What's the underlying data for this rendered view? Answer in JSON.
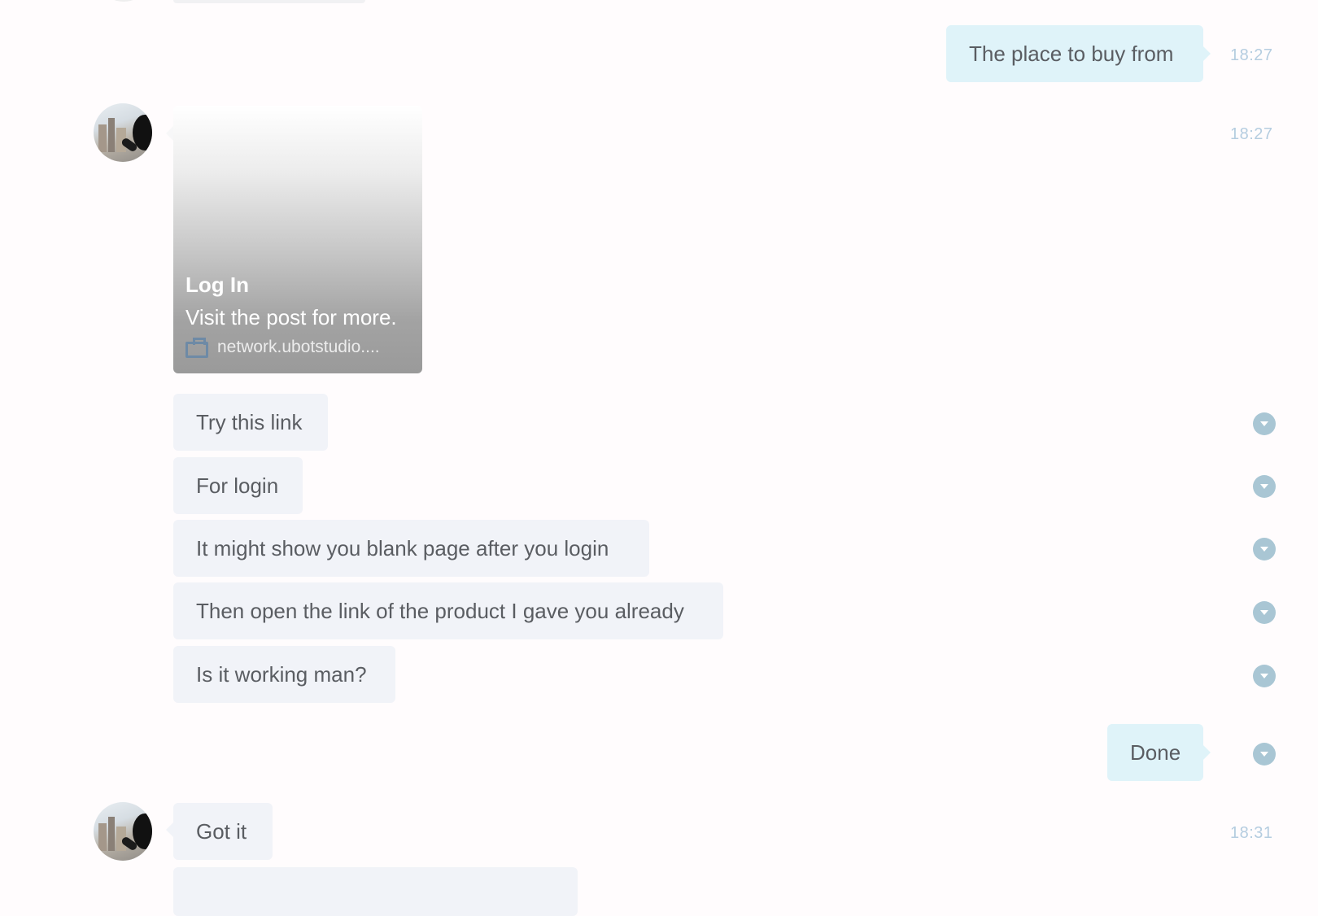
{
  "messages": {
    "out_1": {
      "text": "The place to buy from",
      "time": "18:27"
    },
    "card": {
      "time": "18:27",
      "title": "Log In",
      "description": "Visit the post for more.",
      "site": "network.ubotstudio...."
    },
    "in": [
      {
        "text": "Try this link"
      },
      {
        "text": "For login"
      },
      {
        "text": "It might show you blank page after you login"
      },
      {
        "text": "Then open the link of the product I gave you already"
      },
      {
        "text": "Is it working man?"
      }
    ],
    "out_2": {
      "text": "Done"
    },
    "in_last": {
      "text": "Got it",
      "time": "18:31"
    }
  },
  "icons": {
    "avatar": "user-avatar",
    "link": "briefcase-icon",
    "status": "chevron-down-icon"
  },
  "colors": {
    "incoming_bubble": "#f1f3f8",
    "outgoing_bubble": "#dff3f9",
    "timestamp": "#b5cde0",
    "status_icon": "#a9c6d4"
  }
}
